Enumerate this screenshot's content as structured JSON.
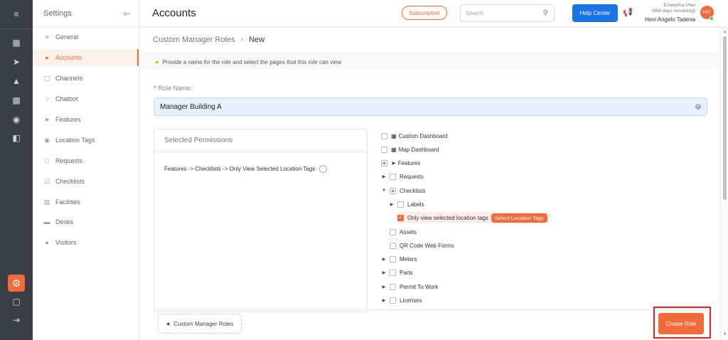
{
  "sidebar": {
    "title": "Settings",
    "items": [
      {
        "label": "General",
        "icon": "sliders-icon"
      },
      {
        "label": "Accounts",
        "icon": "users-icon"
      },
      {
        "label": "Channels",
        "icon": "cube-icon"
      },
      {
        "label": "Chatbot",
        "icon": "chat-icon"
      },
      {
        "label": "Features",
        "icon": "rocket-icon"
      },
      {
        "label": "Location Tags",
        "icon": "pin-icon"
      },
      {
        "label": "Requests",
        "icon": "request-icon"
      },
      {
        "label": "Checklists",
        "icon": "checklist-icon"
      },
      {
        "label": "Facilities",
        "icon": "facilities-icon"
      },
      {
        "label": "Desks",
        "icon": "desk-icon"
      },
      {
        "label": "Visitors",
        "icon": "visitors-icon"
      }
    ],
    "active": "Accounts"
  },
  "header": {
    "title": "Accounts",
    "subscription_label": "Subscription",
    "search_placeholder": "Search",
    "help_label": "Help Center",
    "plan_line1": "Enterprise Plan",
    "plan_line2": "(468 days remaining)",
    "user_name": "Hevi Angelo Tadena",
    "avatar_initials": "HAT"
  },
  "breadcrumb": {
    "parent": "Custom Manager Roles",
    "sep": "›",
    "current": "New"
  },
  "hint": "Provide a name for the role and select the pages that this role can view",
  "role_name": {
    "label": "Role Name:",
    "value": "Manager Building A"
  },
  "selected_permissions": {
    "title": "Selected Permissions",
    "entries": [
      "Features -> Checklists -> Only View Selected Location Tags"
    ]
  },
  "tree": [
    {
      "label": "Custom Dashboard",
      "icon": "dashboard-icon",
      "state": "none"
    },
    {
      "label": "Map Dashboard",
      "icon": "dashboard-icon",
      "state": "none"
    },
    {
      "label": "Features",
      "icon": "rocket-icon",
      "state": "partial"
    },
    {
      "label": "Requests",
      "state": "none"
    },
    {
      "label": "Checklists",
      "state": "partial"
    },
    {
      "label": "Labels",
      "state": "none"
    },
    {
      "label": "Only view selected location tags",
      "state": "checked",
      "action": "Select Location Tags"
    },
    {
      "label": "Assets",
      "state": "none"
    },
    {
      "label": "QR Code Web Forms",
      "state": "none"
    },
    {
      "label": "Meters",
      "state": "none"
    },
    {
      "label": "Parts",
      "state": "none"
    },
    {
      "label": "Permit To Work",
      "state": "none"
    },
    {
      "label": "Licenses",
      "state": "none"
    }
  ],
  "footer": {
    "back_label": "Custom Manager Roles",
    "create_label": "Create Role"
  },
  "colors": {
    "accent": "#f26b3a",
    "primary": "#1a73e8",
    "highlight_box": "#e02424"
  }
}
